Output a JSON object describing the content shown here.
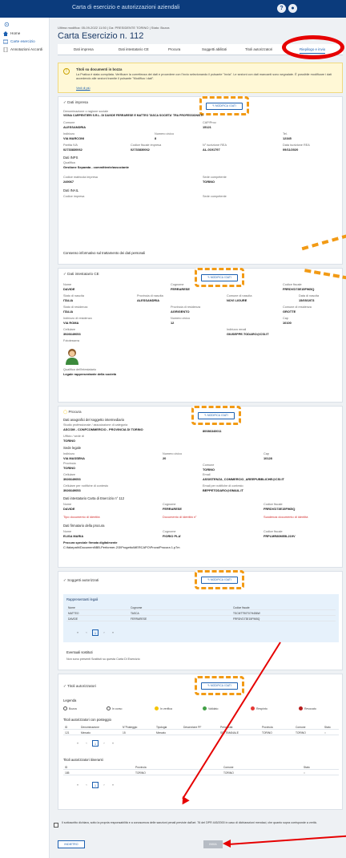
{
  "app": {
    "title": "Carta di esercizio e autorizzazioni aziendali"
  },
  "sidebar": {
    "items": [
      {
        "label": "Home"
      },
      {
        "label": "Carte esercizio"
      },
      {
        "label": "Annotazioni Accordi"
      }
    ]
  },
  "breadcrumb": "Ultima modifica: 05-09-2022 11:50 | Da: PRESIDENTE TORINO | Stato: Bozza",
  "page_title": "Carta Esercizio n. 112",
  "tabs": [
    "Dati impresa",
    "Dati intestatario CE",
    "Procura",
    "Soggetti abilitati",
    "Titoli autorizzatori",
    "Riepilogo e invio"
  ],
  "alert": {
    "title": "Titoli su documenti in bozza",
    "body": "La Pratica è stata compilata. Verificare la correttezza dei dati e procedere con l'invio selezionando il pulsante \"Invia\". Le sezioni con dati mancanti sono segnalate. È possibile modificare i dati accedendo alle sezioni tramite il pulsante \"Modifica i dati\".",
    "link": "Vedi di più"
  },
  "edit_label": "MODIFICA I DATI",
  "impresa": {
    "header": "Dati impresa",
    "denominazione_label": "Denominazione o ragione sociale",
    "denominazione": "VIGNA CARPENTIERI S.R.L. DI DAVIDE FERRARESE E MATTEO TASCA SOCIETA' TRA PROFESSIONISTI",
    "comune_label": "Comune",
    "comune": "ALESSANDRIA",
    "cap_label": "CAP/Prov.",
    "cap": "15121",
    "indirizzo_label": "Indirizzo",
    "indirizzo": "VIA MARCONI",
    "civico_label": "Numero civico",
    "civico": "8",
    "tel_label": "Tel.",
    "tel": "12345",
    "piva_label": "Partita IVA",
    "piva": "02733830062",
    "cf_label": "Codice fiscale impresa",
    "cf": "02733830062",
    "rea_label": "N° iscrizione REA",
    "rea": "AL-0191797",
    "data_label": "Data iscrizione REA",
    "data": "09/11/2020",
    "inps_title": "Dati INPS",
    "qualifica_label": "Qualifica",
    "qualifica": "Gestione Separata - committente/associante",
    "matricola_label": "Codice matricola impresa",
    "matricola": "249067",
    "sede_label": "Sede competente",
    "sede": "TORINO",
    "inail_title": "Dati INAIL",
    "inail_cod_label": "Codice impresa",
    "inail_sede_label": "Sede competente",
    "consenso": "Consenso informativo sul trattamento dei dati personali"
  },
  "intestatario": {
    "header": "Dati intestatario CE",
    "nome_label": "Nome",
    "nome": "DAVIDE",
    "cognome_label": "Cognome",
    "cognome": "FERRARESE",
    "cf_label": "Codice fiscale",
    "cf": "FRRDVD73E15F965Q",
    "stato_n_label": "Stato di nascita",
    "stato_n": "ITALIA",
    "prov_n_label": "Provincia di nascita",
    "prov_n": "ALESSANDRIA",
    "comune_n_label": "Comune di nascita",
    "comune_n": "NOVI LIGURE",
    "data_n_label": "Data di nascita",
    "data_n": "15/05/1973",
    "stato_r_label": "Stato di residenza",
    "stato_r": "ITALIA",
    "prov_r_label": "Provincia di residenza",
    "prov_r": "AGRIGENTO",
    "comune_r_label": "Comune di residenza",
    "comune_r": "GROTTE",
    "ind_label": "Indirizzo di residenza",
    "ind": "VIA ROMA",
    "civ_label": "Numero civico",
    "civ": "12",
    "cap_label": "Cap",
    "cap": "10100",
    "cell_label": "Cellulare",
    "cell": "3926649053",
    "email_label": "Indirizzo email",
    "email": "GIUSEPPE.TODARO@CSI.IT",
    "foto_label": "Fototessera",
    "qual_label": "Qualifica dell'intestatario",
    "qual": "Legale rappresentante della società"
  },
  "procura": {
    "header": "Procura",
    "anag_title": "Dati anagrafici del soggetto intermediario",
    "studio_label": "Studio professionale / associazione di categoria",
    "studio": "ASCOM - CONFCOMMERCIO - PROVINCIA DI TORINO",
    "studio_cf": "80086340011",
    "ufficio_label": "Ufficio / sede di",
    "ufficio": "TORINO",
    "sede_legale": "Sede legale",
    "ind_label": "Indirizzo",
    "ind": "VIA MASSENA",
    "civ_label": "Numero civico",
    "civ": "20",
    "cap_label": "Cap",
    "cap": "10128",
    "prov_label": "Provincia",
    "prov": "TORINO",
    "com_label": "Comune",
    "com": "TORINO",
    "cell_label": "Cellulare",
    "cell": "3926649053",
    "email_label": "Email",
    "email": "ASSISTENZA_COMMERCIO_AREEPUBBLICHE@CSI.IT",
    "cell2_label": "Cellulare per notifiche di contesto",
    "cell2": "3926649053",
    "email2_label": "Email per notifiche di contesto",
    "email2": "BEPPETODARO@GMAIL.IT",
    "int_title": "Dati intestatario Carta di Esercizio n° 112",
    "nome_label": "Nome",
    "nome": "DAVIDE",
    "cognome_label": "Cognome",
    "cognome": "FERRARESE",
    "cf_label": "Codice fiscale",
    "cf": "FRRDVD73E15F965Q",
    "tipo_doc": "Tipo documento di identità",
    "doc_id": "Documento di identità n°",
    "scad_doc": "Scadenza documento di identità",
    "firm_title": "Dati firmatario della procura",
    "fnome": "ELISA MARIA",
    "fcognome": "FIORIO PLA'",
    "fcf": "FRPLMR80M55L219V",
    "pf_label": "Procura speciale firmata digitalmente",
    "pf": "C:\\fakepath\\Documenti\\BB-Performer-2\\3\\Progetto\\MERCAPO\\Prova\\Procura 1.p7m"
  },
  "soggetti": {
    "header": "Soggetti autorizzati",
    "rl_title": "Rappresentanti legali",
    "cols": [
      "Nome",
      "Cognome",
      "Codice fiscale"
    ],
    "rows": [
      [
        "MATTEO",
        "TASCA",
        "TSCMTT90T07H456W"
      ],
      [
        "DAVIDE",
        "FERRARESE",
        "FRRDVD73E15F965Q"
      ]
    ],
    "pages": [
      "«",
      "‹",
      "1",
      "›",
      "»"
    ],
    "es_title": "Eventuali sostituti",
    "es_none": "Non sono presenti Sostituti su questa Carta Di Esercizio"
  },
  "titoli": {
    "header": "Titoli autorizzatori",
    "leg_title": "Legenda",
    "legend": [
      {
        "label": "Bozza",
        "color": "#ffffff"
      },
      {
        "label": "In corso",
        "color": "#ffffff"
      },
      {
        "label": "In verifica",
        "color": "#f5c400"
      },
      {
        "label": "Validato",
        "color": "#43a047"
      },
      {
        "label": "Respinto",
        "color": "#e53935"
      },
      {
        "label": "Revocato",
        "color": "#b71c1c"
      }
    ],
    "pos_title": "Titoli autorizzatori con posteggio",
    "pos_cols": [
      "ID",
      "Denominazione",
      "N°Posteggio",
      "Tipologia",
      "Descrizione PF",
      "Periodicità",
      "Provincia",
      "Comune",
      "Stato"
    ],
    "pos_row": [
      "121",
      "Mercato",
      "15",
      "Mercato",
      "",
      "SETTIMANALE",
      "TORINO",
      "TORINO",
      "○"
    ],
    "it_title": "Titoli autorizzatori itineranti",
    "it_cols": [
      "ID",
      "Provincia",
      "Comune",
      "Stato"
    ],
    "it_row": [
      "185",
      "TORINO",
      "TORINO",
      "○"
    ],
    "pages": [
      "«",
      "‹",
      "1",
      "›",
      "»"
    ]
  },
  "footer": {
    "decl": "Il sottoscritto dichiara, sotto la propria responsabilità e a conoscenza delle sanzioni penali previste dall'art. 76 del DPR 445/2000 in caso di dichiarazioni mendaci, che quanto sopra corrisponde a verità.",
    "back": "INDIETRO",
    "next": "INVIA"
  }
}
